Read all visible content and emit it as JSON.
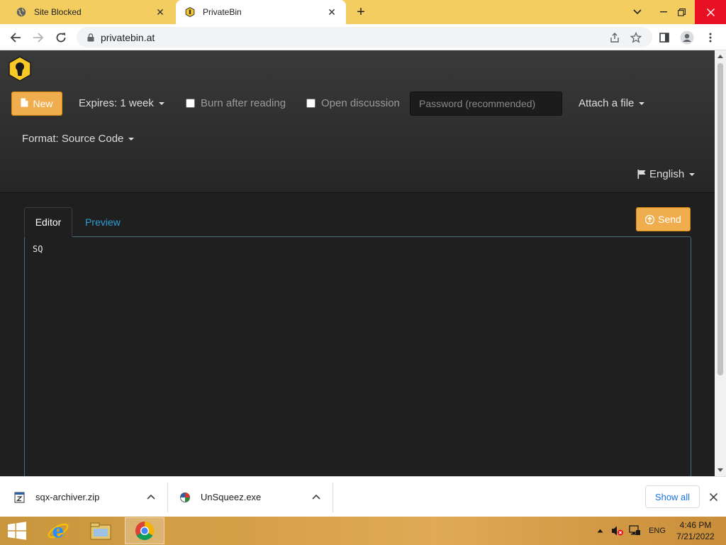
{
  "browser": {
    "tabs": [
      {
        "title": "Site Blocked",
        "icon": "globe-icon",
        "close": "✕"
      },
      {
        "title": "PrivateBin",
        "icon": "privatebin-icon",
        "close": "✕"
      }
    ],
    "new_tab": "+",
    "address": "privatebin.at"
  },
  "privatebin": {
    "new_label": "New",
    "expires_label": "Expires: 1 week",
    "burn_label": "Burn after reading",
    "discussion_label": "Open discussion",
    "password_placeholder": "Password (recommended)",
    "attach_label": "Attach a file",
    "format_label": "Format: Source Code",
    "language_label": "English",
    "tab_editor": "Editor",
    "tab_preview": "Preview",
    "send_label": "Send",
    "editor_text": "SQ",
    "accent": "#f0ad4e",
    "link_color": "#2a9fd6"
  },
  "downloads": {
    "items": [
      {
        "name": "sqx-archiver.zip",
        "icon": "zip-file-icon"
      },
      {
        "name": "UnSqueez.exe",
        "icon": "exe-file-icon"
      }
    ],
    "show_all": "Show all"
  },
  "taskbar": {
    "lang": "ENG",
    "time": "4:46 PM",
    "date": "7/21/2022"
  }
}
